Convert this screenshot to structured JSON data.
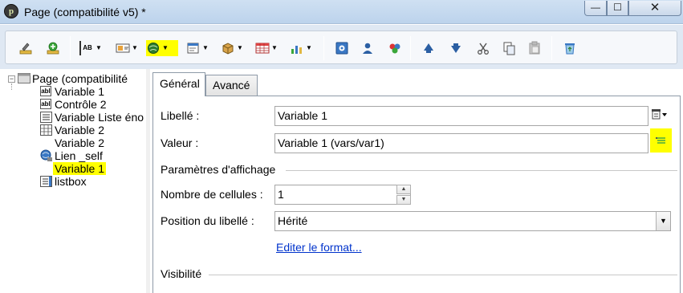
{
  "window": {
    "title": "Page (compatibilité v5) *",
    "app_icon_letter": "p",
    "minimize": "—",
    "maximize": "☐",
    "close": "✕"
  },
  "toolbar": {
    "buttons": [
      {
        "icon": "edit-icon"
      },
      {
        "icon": "add-green-icon"
      },
      {
        "icon": "text-field-icon",
        "text": "AB"
      },
      {
        "icon": "image-field-icon"
      },
      {
        "icon": "globe-icon",
        "highlighted": true
      },
      {
        "icon": "form-icon"
      },
      {
        "icon": "package-icon"
      },
      {
        "icon": "table-icon"
      },
      {
        "icon": "chart-icon"
      },
      {
        "icon": "page-icon"
      },
      {
        "icon": "user-icon"
      },
      {
        "icon": "colors-icon"
      },
      {
        "icon": "arrow-up-icon"
      },
      {
        "icon": "arrow-down-icon"
      },
      {
        "icon": "cut-icon"
      },
      {
        "icon": "copy-icon"
      },
      {
        "icon": "paste-icon"
      },
      {
        "icon": "recycle-icon"
      }
    ]
  },
  "tree": {
    "root": "Page (compatibilité",
    "items": [
      {
        "label": "Variable 1",
        "icon": "abl"
      },
      {
        "label": "Contrôle 2",
        "icon": "abl"
      },
      {
        "label": "Variable Liste éno",
        "icon": "list"
      },
      {
        "label": "Variable 2",
        "icon": "grid"
      },
      {
        "label": "Variable 2",
        "icon": "none"
      },
      {
        "label": "Lien _self",
        "icon": "globe"
      },
      {
        "label": "Variable 1",
        "icon": "none",
        "selected": true
      },
      {
        "label": "listbox",
        "icon": "list"
      }
    ]
  },
  "tabs": [
    {
      "label": "Général",
      "active": true
    },
    {
      "label": "Avancé",
      "active": false
    }
  ],
  "form": {
    "libelle_label": "Libellé :",
    "libelle_value": "Variable 1",
    "valeur_label": "Valeur :",
    "valeur_value": "Variable 1 (vars/var1)",
    "display_group": "Paramètres d'affichage",
    "cells_label": "Nombre de cellules :",
    "cells_value": "1",
    "position_label": "Position du libellé :",
    "position_value": "Hérité",
    "format_link": "Editer le format...",
    "visibility_group": "Visibilité"
  },
  "colors": {
    "highlight": "#ffff00",
    "link": "#0033cc"
  }
}
